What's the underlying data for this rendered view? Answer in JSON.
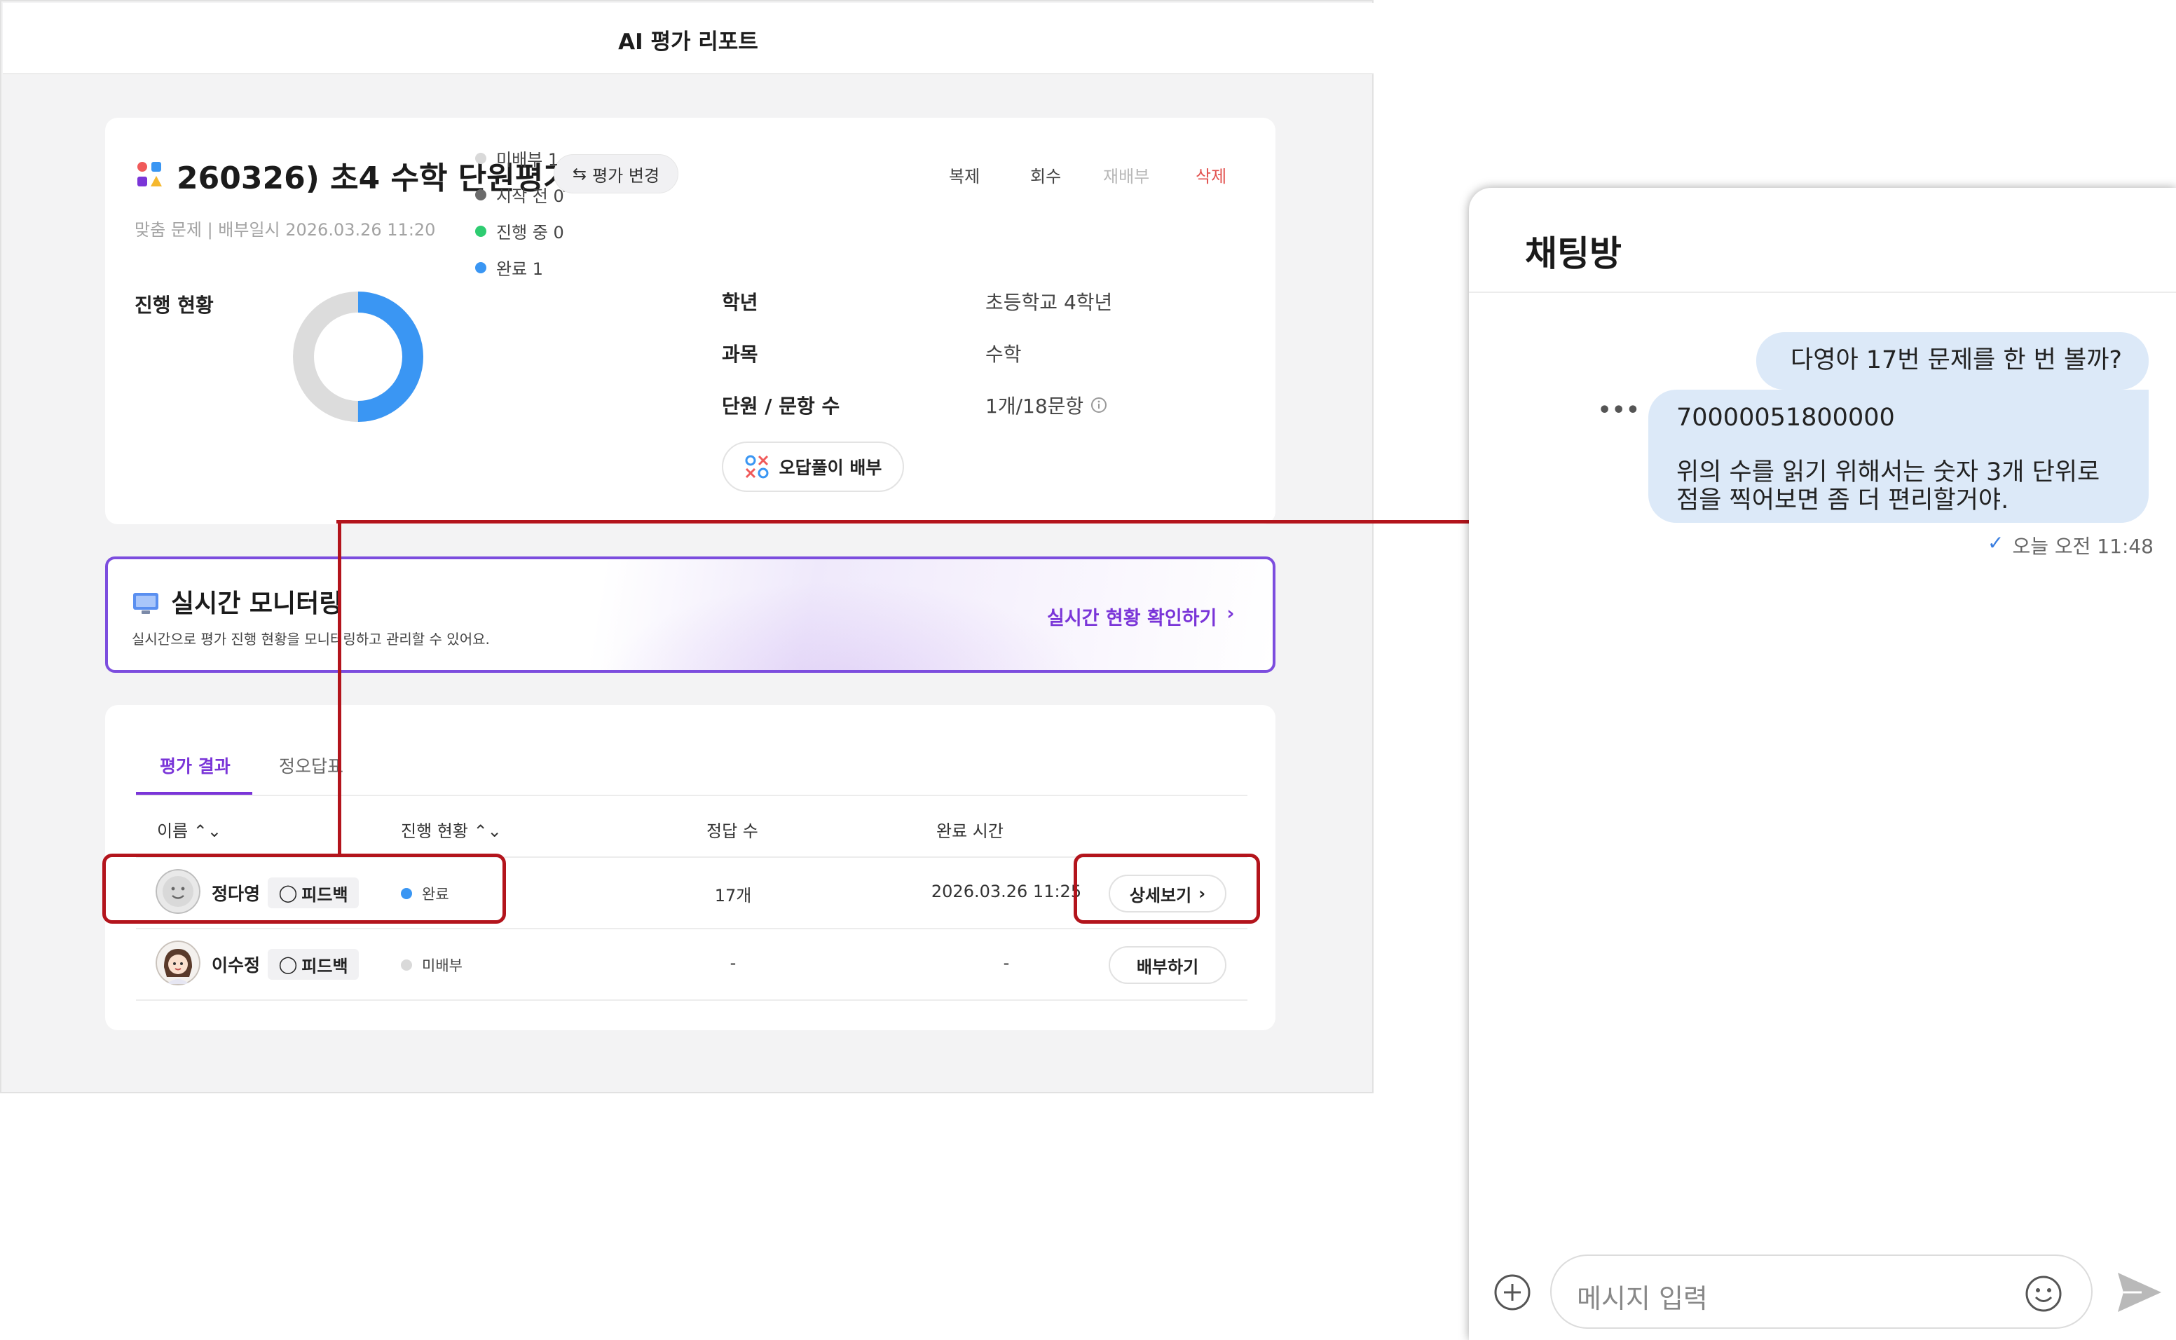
{
  "report": {
    "title": "AI 평가 리포트",
    "exam_title": "260326) 초4 수학 단원평가",
    "change_label": "평가 변경",
    "actions": {
      "copy": "복제",
      "recall": "회수",
      "redistribute": "재배부",
      "delete": "삭제"
    },
    "subtitle": "맞춤 문제 | 배부일시 2026.03.26 11:20",
    "progress": {
      "title": "진행 현황",
      "complete_fraction": 0.5,
      "legend": [
        {
          "label": "미배부 1",
          "color": "#d9d9d9"
        },
        {
          "label": "시작 전 0",
          "color": "#6b6b6b"
        },
        {
          "label": "진행 중 0",
          "color": "#2ecc71"
        },
        {
          "label": "완료 1",
          "color": "#3a96f3"
        }
      ]
    },
    "info": [
      {
        "label": "학년",
        "value": "초등학교 4학년"
      },
      {
        "label": "과목",
        "value": "수학"
      },
      {
        "label": "단원 / 문항 수",
        "value": "1개/18문항"
      }
    ],
    "wrong_answer_btn": "오답풀이 배부",
    "monitor": {
      "title": "실시간 모니터링",
      "desc": "실시간으로 평가 진행 현황을 모니터링하고 관리할 수 있어요.",
      "link": "실시간 현황 확인하기",
      "link_arrow": "›"
    },
    "tabs": [
      "평가 결과",
      "정오답표"
    ],
    "columns": {
      "name": "이름 ⌃⌄",
      "progress": "진행 현황 ⌃⌄",
      "correct": "정답 수",
      "done_time": "완료 시간"
    },
    "rows": [
      {
        "name": "정다영",
        "feedback": "피드백",
        "status": "완료",
        "status_color": "#3a96f3",
        "correct": "17개",
        "time": "2026.03.26 11:25",
        "action": "상세보기",
        "action_arrow": "›"
      },
      {
        "name": "이수정",
        "feedback": "피드백",
        "status": "미배부",
        "status_color": "#d9d9d9",
        "correct": "-",
        "time": "-",
        "action": "배부하기",
        "action_arrow": ""
      }
    ]
  },
  "chat": {
    "title": "채팅방",
    "more": "•••",
    "messages": [
      {
        "text": "다영아 17번 문제를 한 번 볼까?"
      },
      {
        "number": "70000051800000",
        "text": "위의 수를 읽기 위해서는 숫자 3개 단위로\n점을 찍어보면 좀 더 편리할거야."
      }
    ],
    "time_check": "✓",
    "time": "오늘 오전 11:48",
    "input_placeholder": "메시지 입력"
  },
  "colors": {
    "accent": "#7a35d8",
    "highlight": "#b3141c",
    "bubble": "#dce9f8",
    "delete": "#e2524f"
  }
}
